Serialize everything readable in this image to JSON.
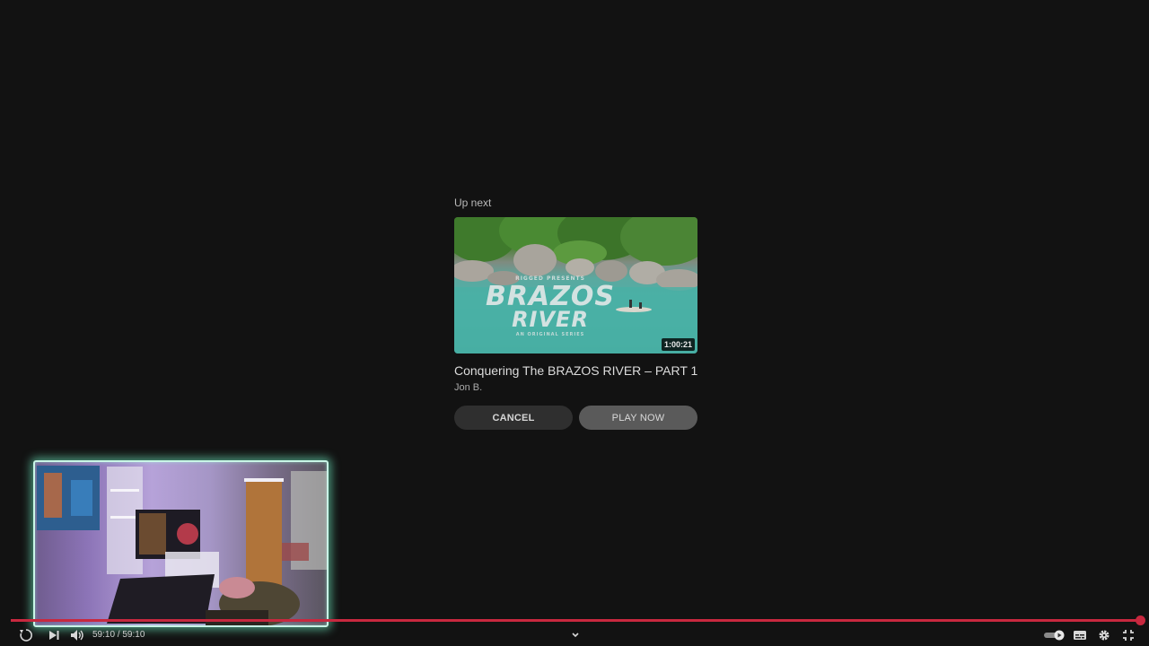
{
  "upnext": {
    "label": "Up next",
    "duration": "1:00:21",
    "title": "Conquering The BRAZOS RIVER – PART 1",
    "channel": "Jon B.",
    "thumbnail": {
      "pre": "RIGGED PRESENTS",
      "line1": "BRAZOS",
      "line2": "RIVER",
      "sub": "AN ORIGINAL SERIES"
    },
    "cancel_label": "CANCEL",
    "play_label": "PLAY NOW"
  },
  "player": {
    "timecode": "59:10 / 59:10",
    "progress_percent": 100,
    "accent_color": "#c8283f"
  },
  "icons": {
    "replay": "replay-icon",
    "next": "next-icon",
    "volume": "volume-icon",
    "chevron": "chevron-down-icon",
    "autoplay": "autoplay-toggle-icon",
    "subtitles": "subtitles-icon",
    "settings": "gear-icon",
    "fullscreen_exit": "exit-fullscreen-icon"
  }
}
